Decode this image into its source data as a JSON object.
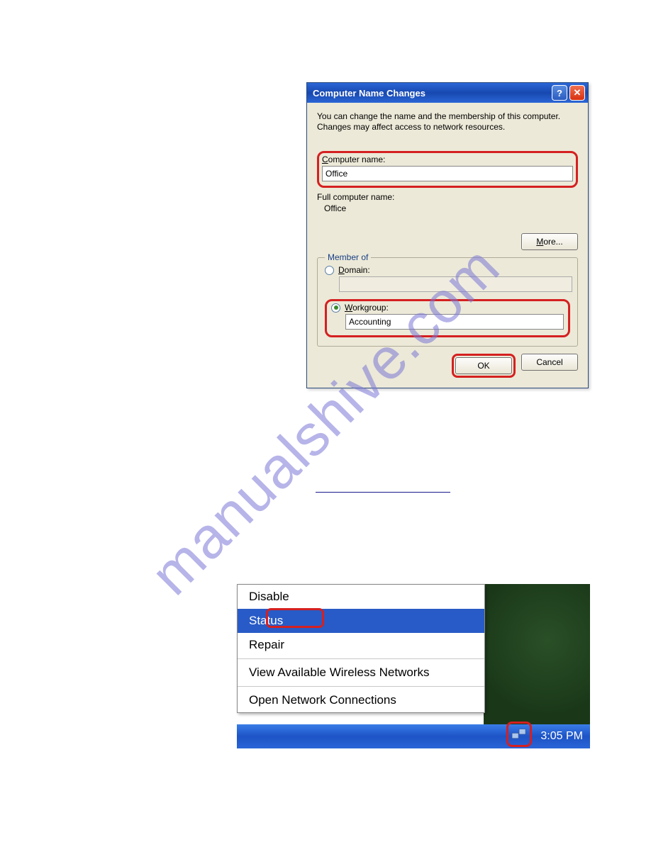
{
  "watermark": "manualshive.com",
  "dialog": {
    "title": "Computer Name Changes",
    "help_symbol": "?",
    "close_symbol": "✕",
    "description": "You can change the name and the membership of this computer. Changes may affect access to network resources.",
    "computer_name_label": "Computer name:",
    "computer_name_value": "Office",
    "full_name_label": "Full computer name:",
    "full_name_value": "Office",
    "more_button": "More...",
    "member_of_label": "Member of",
    "domain_label": "Domain:",
    "workgroup_label": "Workgroup:",
    "workgroup_value": "Accounting",
    "ok_button": "OK",
    "cancel_button": "Cancel"
  },
  "contextmenu": {
    "items": [
      "Disable",
      "Status",
      "Repair",
      "View Available Wireless Networks",
      "Open Network Connections"
    ],
    "selected_index": 1
  },
  "taskbar": {
    "time": "3:05 PM"
  }
}
